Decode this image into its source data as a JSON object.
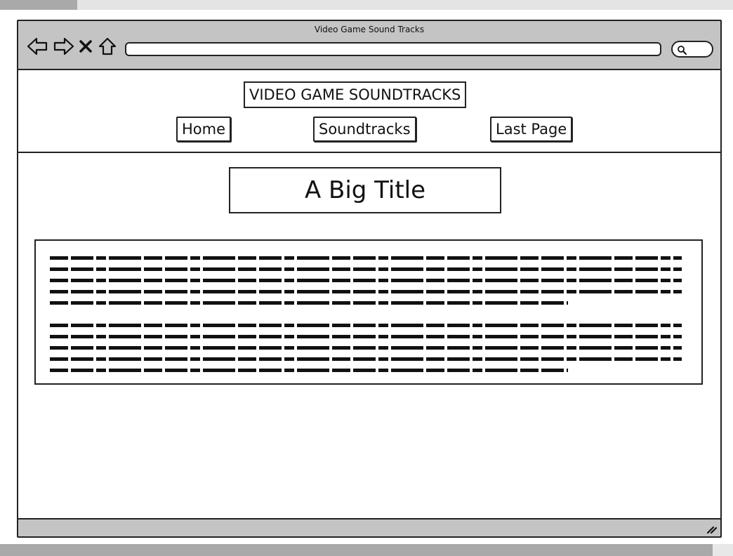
{
  "browser": {
    "window_title": "Video Game Sound Tracks",
    "url": "",
    "icons": [
      "back-arrow-icon",
      "forward-arrow-icon",
      "close-icon",
      "home-icon",
      "search-icon",
      "resize-grip-icon"
    ]
  },
  "site": {
    "logo_text": "VIDEO GAME SOUNDTRACKS",
    "nav": {
      "home": "Home",
      "soundtracks": "Soundtracks",
      "last_page": "Last Page"
    }
  },
  "main": {
    "title": "A Big Title",
    "paragraphs": [
      {
        "lines": 5
      },
      {
        "lines": 5
      }
    ]
  },
  "colors": {
    "chrome": "#c4c4c4",
    "stroke": "#222222",
    "background": "#ffffff"
  }
}
